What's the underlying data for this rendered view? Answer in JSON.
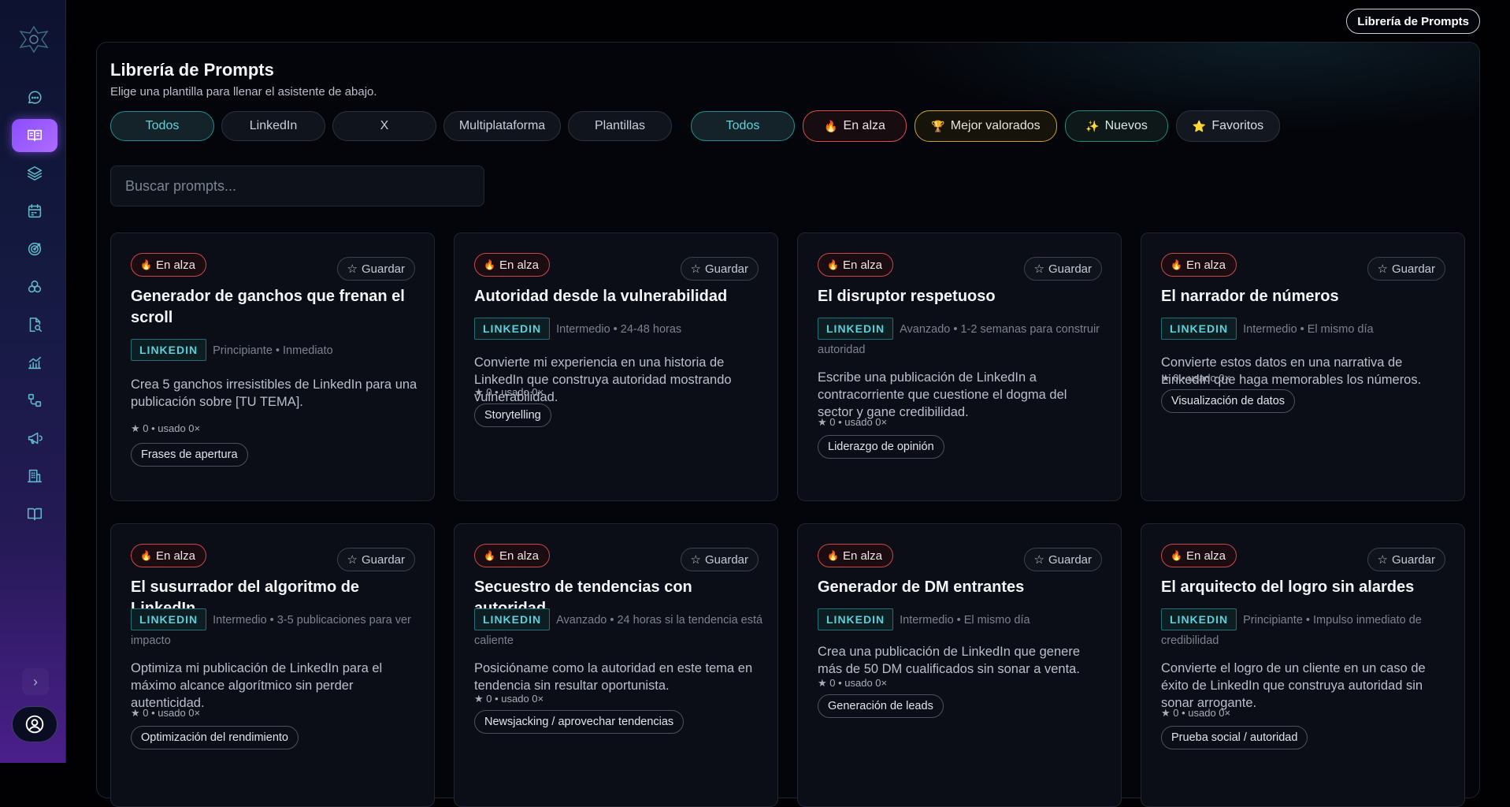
{
  "top_button": "Librería de Prompts",
  "panel": {
    "title": "Librería de Prompts",
    "subtitle": "Elige una plantilla para llenar el asistente de abajo."
  },
  "platform_filters": [
    "Todos",
    "LinkedIn",
    "X",
    "Multiplataforma",
    "Plantillas"
  ],
  "sort_filters": [
    "Todos",
    "En alza",
    "Mejor valorados",
    "Nuevos",
    "Favoritos"
  ],
  "search": {
    "placeholder": "Buscar prompts...",
    "value": ""
  },
  "cards": [
    {
      "badge": "En alza",
      "save": "Guardar",
      "title": "Generador de ganchos que frenan el scroll",
      "platform": "LINKEDIN",
      "meta": "Principiante • Inmediato",
      "description": "Crea 5 ganchos irresistibles de LinkedIn para una publicación sobre [TU TEMA].",
      "stats": "★ 0 • usado 0×",
      "category": "Frases de apertura"
    },
    {
      "badge": "En alza",
      "save": "Guardar",
      "title": "Autoridad desde la vulnerabilidad",
      "platform": "LINKEDIN",
      "meta": "Intermedio • 24-48 horas",
      "description": "Convierte mi experiencia en una historia de LinkedIn que construya autoridad mostrando vulnerabilidad.",
      "stats": "★ 0 • usado 0×",
      "category": "Storytelling"
    },
    {
      "badge": "En alza",
      "save": "Guardar",
      "title": "El disruptor respetuoso",
      "platform": "LINKEDIN",
      "meta": "Avanzado • 1-2 semanas para construir autoridad",
      "description": "Escribe una publicación de LinkedIn a contracorriente que cuestione el dogma del sector y gane credibilidad.",
      "stats": "★ 0 • usado 0×",
      "category": "Liderazgo de opinión"
    },
    {
      "badge": "En alza",
      "save": "Guardar",
      "title": "El narrador de números",
      "platform": "LINKEDIN",
      "meta": "Intermedio • El mismo día",
      "description": "Convierte estos datos en una narrativa de LinkedIn que haga memorables los números.",
      "stats": "★ 0 • usado 0×",
      "category": "Visualización de datos"
    },
    {
      "badge": "En alza",
      "save": "Guardar",
      "title": "El susurrador del algoritmo de LinkedIn",
      "platform": "LINKEDIN",
      "meta": "Intermedio • 3-5 publicaciones para ver impacto",
      "description": "Optimiza mi publicación de LinkedIn para el máximo alcance algorítmico sin perder autenticidad.",
      "stats": "★ 0 • usado 0×",
      "category": "Optimización del rendimiento"
    },
    {
      "badge": "En alza",
      "save": "Guardar",
      "title": "Secuestro de tendencias con autoridad",
      "platform": "LINKEDIN",
      "meta": "Avanzado • 24 horas si la tendencia está caliente",
      "description": "Posicióname como la autoridad en este tema en tendencia sin resultar oportunista.",
      "stats": "★ 0 • usado 0×",
      "category": "Newsjacking / aprovechar tendencias"
    },
    {
      "badge": "En alza",
      "save": "Guardar",
      "title": "Generador de DM entrantes",
      "platform": "LINKEDIN",
      "meta": "Intermedio • El mismo día",
      "description": "Crea una publicación de LinkedIn que genere más de 50 DM cualificados sin sonar a venta.",
      "stats": "★ 0 • usado 0×",
      "category": "Generación de leads"
    },
    {
      "badge": "En alza",
      "save": "Guardar",
      "title": "El arquitecto del logro sin alardes",
      "platform": "LINKEDIN",
      "meta": "Principiante • Impulso inmediato de credibilidad",
      "description": "Convierte el logro de un cliente en un caso de éxito de LinkedIn que construya autoridad sin sonar arrogante.",
      "stats": "★ 0 • usado 0×",
      "category": "Prueba social / autoridad"
    }
  ],
  "sidebar_icons": [
    "logo",
    "chat-icon",
    "library-icon",
    "layers-icon",
    "calendar-icon",
    "target-icon",
    "circles-icon",
    "search-file-icon",
    "chart-icon",
    "flow-icon",
    "megaphone-icon",
    "building-icon",
    "book-icon",
    "chevron-right-icon",
    "user-circle-icon"
  ],
  "colors": {
    "accent_teal": "#5fd3d8",
    "active_nav": "#8a4dff",
    "hot_red": "#c94848"
  }
}
